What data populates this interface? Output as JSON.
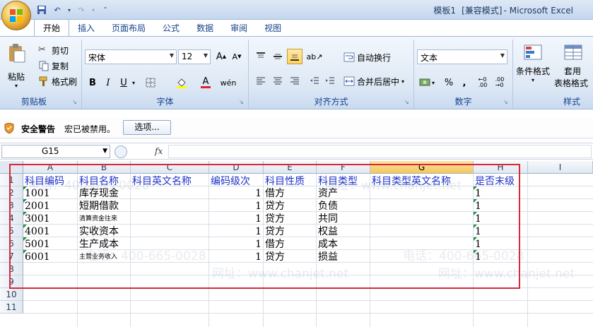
{
  "window": {
    "title": "模板1",
    "mode": "[兼容模式]",
    "app": "Microsoft Excel"
  },
  "tabs": [
    {
      "label": "开始",
      "active": true
    },
    {
      "label": "插入"
    },
    {
      "label": "页面布局"
    },
    {
      "label": "公式"
    },
    {
      "label": "数据"
    },
    {
      "label": "审阅"
    },
    {
      "label": "视图"
    }
  ],
  "ribbon": {
    "clipboard": {
      "label": "剪贴板",
      "paste": "粘贴",
      "cut": "剪切",
      "copy": "复制",
      "format_painter": "格式刷"
    },
    "font": {
      "label": "字体",
      "font_name": "宋体",
      "font_size": "12",
      "bold": "B",
      "italic": "I",
      "underline": "U"
    },
    "alignment": {
      "label": "对齐方式",
      "wrap_text": "自动换行",
      "merge_center": "合并后居中"
    },
    "number": {
      "label": "数字",
      "format": "文本",
      "percent": "%",
      "comma": ","
    },
    "styles": {
      "label": "样式",
      "conditional_format": "条件格式",
      "apply_table": "套用",
      "table_format": "表格格式"
    }
  },
  "security": {
    "title": "安全警告",
    "message": "宏已被禁用。",
    "options_button": "选项..."
  },
  "formula_bar": {
    "name_box": "G15",
    "fx": "fx",
    "value": ""
  },
  "watermark": {
    "phone": "电话：400-665-0028",
    "site": "网址：www.chanjet.net"
  },
  "sheet": {
    "selected_column": "G",
    "columns": [
      "A",
      "B",
      "C",
      "D",
      "E",
      "F",
      "G",
      "H",
      "I"
    ],
    "row_numbers": [
      "1",
      "2",
      "3",
      "4",
      "5",
      "6",
      "7",
      "8",
      "9",
      "10",
      "11"
    ],
    "headers": [
      "科目编码",
      "科目名称",
      "科目英文名称",
      "编码级次",
      "科目性质",
      "科目类型",
      "科目类型英文名称",
      "是否末级"
    ],
    "rows": [
      {
        "code": "1001",
        "name": "库存现金",
        "level": "1",
        "nature": "借方",
        "type": "资产",
        "last": "1",
        "small": false
      },
      {
        "code": "2001",
        "name": "短期借款",
        "level": "1",
        "nature": "贷方",
        "type": "负债",
        "last": "1",
        "small": false
      },
      {
        "code": "3001",
        "name": "清算资金往来",
        "level": "1",
        "nature": "贷方",
        "type": "共同",
        "last": "1",
        "small": true
      },
      {
        "code": "4001",
        "name": "实收资本",
        "level": "1",
        "nature": "贷方",
        "type": "权益",
        "last": "1",
        "small": false
      },
      {
        "code": "5001",
        "name": "生产成本",
        "level": "1",
        "nature": "借方",
        "type": "成本",
        "last": "1",
        "small": false
      },
      {
        "code": "6001",
        "name": "主营业务收入",
        "level": "1",
        "nature": "贷方",
        "type": "损益",
        "last": "1",
        "small": true
      }
    ]
  }
}
